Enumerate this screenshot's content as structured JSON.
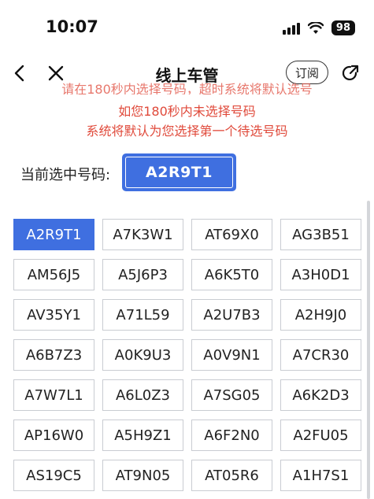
{
  "status_bar": {
    "time": "10:07",
    "battery": "98"
  },
  "nav": {
    "title": "线上车管",
    "subscribe_label": "订阅"
  },
  "notice": {
    "cut_line": "请在180秒内选择号码，超时系统将默认选号",
    "line1": "如您180秒内未选择号码",
    "line2": "系统将默认为您选择第一个待选号码"
  },
  "current": {
    "label": "当前选中号码:",
    "value": "A2R9T1"
  },
  "plates": [
    "A2R9T1",
    "A7K3W1",
    "AT69X0",
    "AG3B51",
    "AM56J5",
    "A5J6P3",
    "A6K5T0",
    "A3H0D1",
    "AV35Y1",
    "A71L59",
    "A2U7B3",
    "A2H9J0",
    "A6B7Z3",
    "A0K9U3",
    "A0V9N1",
    "A7CR30",
    "A7W7L1",
    "A6L0Z3",
    "A7SG05",
    "A6K2D3",
    "AP16W0",
    "A5H9Z1",
    "A6F2N0",
    "A2FU05",
    "AS19C5",
    "AT9N05",
    "AT05R6",
    "A1H7S1"
  ],
  "selected_index": 0,
  "colors": {
    "accent": "#3f6fe0",
    "notice": "#e04a3b",
    "cell_border": "#c9ccd2"
  },
  "icons": [
    "back-icon",
    "close-icon",
    "share-icon",
    "signal-icon",
    "wifi-icon",
    "battery-icon"
  ]
}
